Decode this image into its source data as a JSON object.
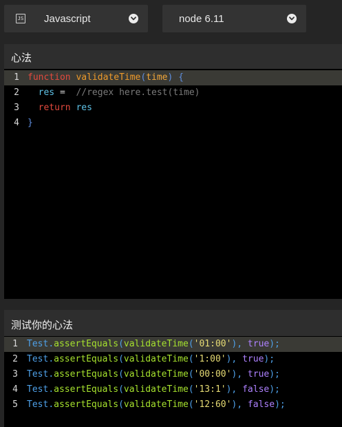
{
  "toolbar": {
    "language": {
      "label": "Javascript",
      "icon": "js-file-icon",
      "icon_text": "JS"
    },
    "version": {
      "label": "node 6.11"
    }
  },
  "solution_panel": {
    "title": "心法",
    "lines": [
      {
        "number": "1",
        "tokens": [
          {
            "text": "function",
            "kind": "kw"
          },
          {
            "text": " ",
            "kind": "op"
          },
          {
            "text": "validateTime",
            "kind": "fn"
          },
          {
            "text": "(",
            "kind": "brace"
          },
          {
            "text": "time",
            "kind": "param"
          },
          {
            "text": ") {",
            "kind": "brace"
          }
        ]
      },
      {
        "number": "2",
        "tokens": [
          {
            "text": "  ",
            "kind": "op"
          },
          {
            "text": "res",
            "kind": "var"
          },
          {
            "text": " =  ",
            "kind": "op"
          },
          {
            "text": "//regex here.test(time)",
            "kind": "cmt"
          }
        ]
      },
      {
        "number": "3",
        "tokens": [
          {
            "text": "  ",
            "kind": "op"
          },
          {
            "text": "return",
            "kind": "kw"
          },
          {
            "text": " ",
            "kind": "op"
          },
          {
            "text": "res",
            "kind": "var"
          }
        ]
      },
      {
        "number": "4",
        "tokens": [
          {
            "text": "}",
            "kind": "brace"
          }
        ]
      }
    ]
  },
  "tests_panel": {
    "title": "测试你的心法",
    "lines": [
      {
        "number": "1",
        "tokens": [
          {
            "text": "Test",
            "kind": "obj"
          },
          {
            "text": ".",
            "kind": "punc"
          },
          {
            "text": "assertEquals",
            "kind": "method"
          },
          {
            "text": "(",
            "kind": "punc"
          },
          {
            "text": "validateTime",
            "kind": "method"
          },
          {
            "text": "(",
            "kind": "punc"
          },
          {
            "text": "'01:00'",
            "kind": "str"
          },
          {
            "text": "), ",
            "kind": "punc"
          },
          {
            "text": "true",
            "kind": "bool"
          },
          {
            "text": ");",
            "kind": "punc"
          }
        ]
      },
      {
        "number": "2",
        "tokens": [
          {
            "text": "Test",
            "kind": "obj"
          },
          {
            "text": ".",
            "kind": "punc"
          },
          {
            "text": "assertEquals",
            "kind": "method"
          },
          {
            "text": "(",
            "kind": "punc"
          },
          {
            "text": "validateTime",
            "kind": "method"
          },
          {
            "text": "(",
            "kind": "punc"
          },
          {
            "text": "'1:00'",
            "kind": "str"
          },
          {
            "text": "), ",
            "kind": "punc"
          },
          {
            "text": "true",
            "kind": "bool"
          },
          {
            "text": ");",
            "kind": "punc"
          }
        ]
      },
      {
        "number": "3",
        "tokens": [
          {
            "text": "Test",
            "kind": "obj"
          },
          {
            "text": ".",
            "kind": "punc"
          },
          {
            "text": "assertEquals",
            "kind": "method"
          },
          {
            "text": "(",
            "kind": "punc"
          },
          {
            "text": "validateTime",
            "kind": "method"
          },
          {
            "text": "(",
            "kind": "punc"
          },
          {
            "text": "'00:00'",
            "kind": "str"
          },
          {
            "text": "), ",
            "kind": "punc"
          },
          {
            "text": "true",
            "kind": "bool"
          },
          {
            "text": ");",
            "kind": "punc"
          }
        ]
      },
      {
        "number": "4",
        "tokens": [
          {
            "text": "Test",
            "kind": "obj"
          },
          {
            "text": ".",
            "kind": "punc"
          },
          {
            "text": "assertEquals",
            "kind": "method"
          },
          {
            "text": "(",
            "kind": "punc"
          },
          {
            "text": "validateTime",
            "kind": "method"
          },
          {
            "text": "(",
            "kind": "punc"
          },
          {
            "text": "'13:1'",
            "kind": "str"
          },
          {
            "text": "), ",
            "kind": "punc"
          },
          {
            "text": "false",
            "kind": "bool"
          },
          {
            "text": ");",
            "kind": "punc"
          }
        ]
      },
      {
        "number": "5",
        "tokens": [
          {
            "text": "Test",
            "kind": "obj"
          },
          {
            "text": ".",
            "kind": "punc"
          },
          {
            "text": "assertEquals",
            "kind": "method"
          },
          {
            "text": "(",
            "kind": "punc"
          },
          {
            "text": "validateTime",
            "kind": "method"
          },
          {
            "text": "(",
            "kind": "punc"
          },
          {
            "text": "'12:60'",
            "kind": "str"
          },
          {
            "text": "), ",
            "kind": "punc"
          },
          {
            "text": "false",
            "kind": "bool"
          },
          {
            "text": ");",
            "kind": "punc"
          }
        ]
      }
    ]
  },
  "colors": {
    "background": "#252525",
    "editor_background": "#000000",
    "active_line": "#3a3a35",
    "keyword": "#e2493d",
    "function_name": "#ee9a2a",
    "string": "#e6db74",
    "boolean": "#ae81ff",
    "method": "#a6e22e",
    "comment": "#7a7a7a"
  }
}
